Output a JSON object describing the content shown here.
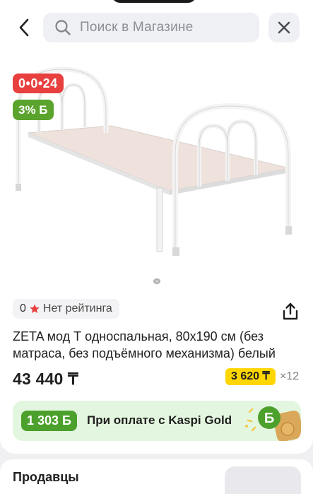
{
  "header": {
    "search_placeholder": "Поиск в Магазине",
    "back_icon": "chevron-left-icon",
    "close_icon": "close-icon",
    "search_icon": "search-icon"
  },
  "product": {
    "badges": {
      "timer": "0•0•24",
      "bonus": "3% Б"
    },
    "gallery": {
      "image": "white-metal-single-bed-frame",
      "dots": 1
    },
    "rating": {
      "value": "0",
      "label": "Нет рейтинга"
    },
    "title": "ZETA мод Т односпальная, 80x190 см (без матраса, без подъёмного механизма) белый",
    "price": "43 440 ₸",
    "installment": {
      "amount": "3 620 ₸",
      "multiplier": "×12"
    }
  },
  "kaspi_gold": {
    "bonus_amount": "1 303 Б",
    "text": "При оплате с Kaspi Gold"
  },
  "sellers": {
    "title": "Продавцы"
  },
  "colors": {
    "timer_badge": "#e8403f",
    "bonus_badge": "#5aa32c",
    "installment_badge": "#ffd600",
    "gold_banner_bg": "#e3f6df",
    "star": "#e8403f"
  }
}
